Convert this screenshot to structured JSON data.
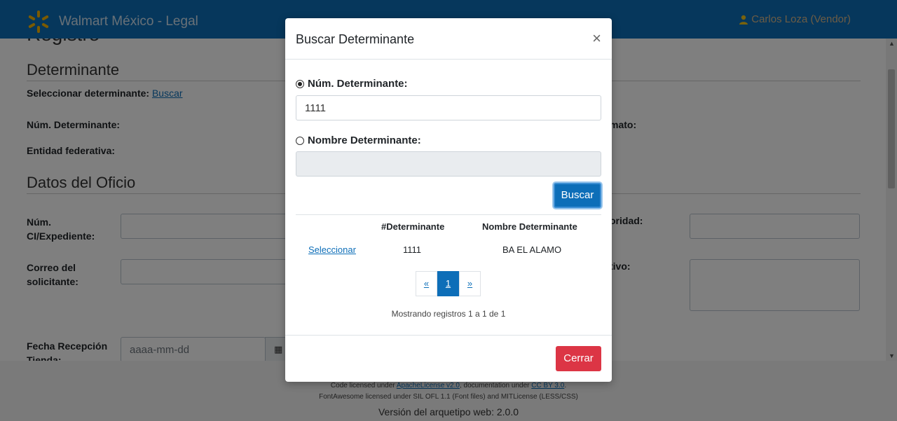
{
  "navbar": {
    "brand": "Walmart México - Legal",
    "user": "Carlos Loza (Vendor)",
    "brand_color": "#0d6eb8",
    "user_color": "#f0c419"
  },
  "page": {
    "section_determinante": "Determinante",
    "select_label": "Seleccionar determinante:",
    "select_link": "Buscar",
    "num_determinante_label": "Núm. Determinante:",
    "entidad_label": "Entidad federativa:",
    "formato_label_partial": "mato:",
    "section_oficio": "Datos del Oficio",
    "num_ci_label": "Núm. CI/Expediente:",
    "autoridad_label_partial": "oridad:",
    "correo_label": "Correo del solicitante:",
    "motivo_label_partial": "tivo:",
    "fecha_label": "Fecha Recepción Tienda:",
    "fecha_placeholder": "aaaa-mm-dd"
  },
  "footer": {
    "line1_a": "Code licensed under ",
    "line1_link1": "ApacheLicense v2.0",
    "line1_b": ", documentation under ",
    "line1_link2": "CC BY 3.0",
    "line1_c": ".",
    "line2": "FontAwesome licensed under SIL OFL 1.1 (Font files) and MITLicense (LESS/CSS)",
    "line3": "Versión del arquetipo web: 2.0.0"
  },
  "modal": {
    "title": "Buscar Determinante",
    "close": "×",
    "radio_num_label": "Núm. Determinante:",
    "num_value": "1111",
    "radio_nombre_label": "Nombre Determinante:",
    "nombre_value": "",
    "search_button": "Buscar",
    "columns": [
      "",
      "#Determinante",
      "Nombre Determinante"
    ],
    "rows": [
      {
        "action": "Seleccionar",
        "num": "1111",
        "nombre": "BA EL ALAMO"
      }
    ],
    "pager": {
      "prev": "«",
      "current": "1",
      "next": "»"
    },
    "showing": "Mostrando registros 1 a 1 de 1",
    "close_button": "Cerrar"
  }
}
